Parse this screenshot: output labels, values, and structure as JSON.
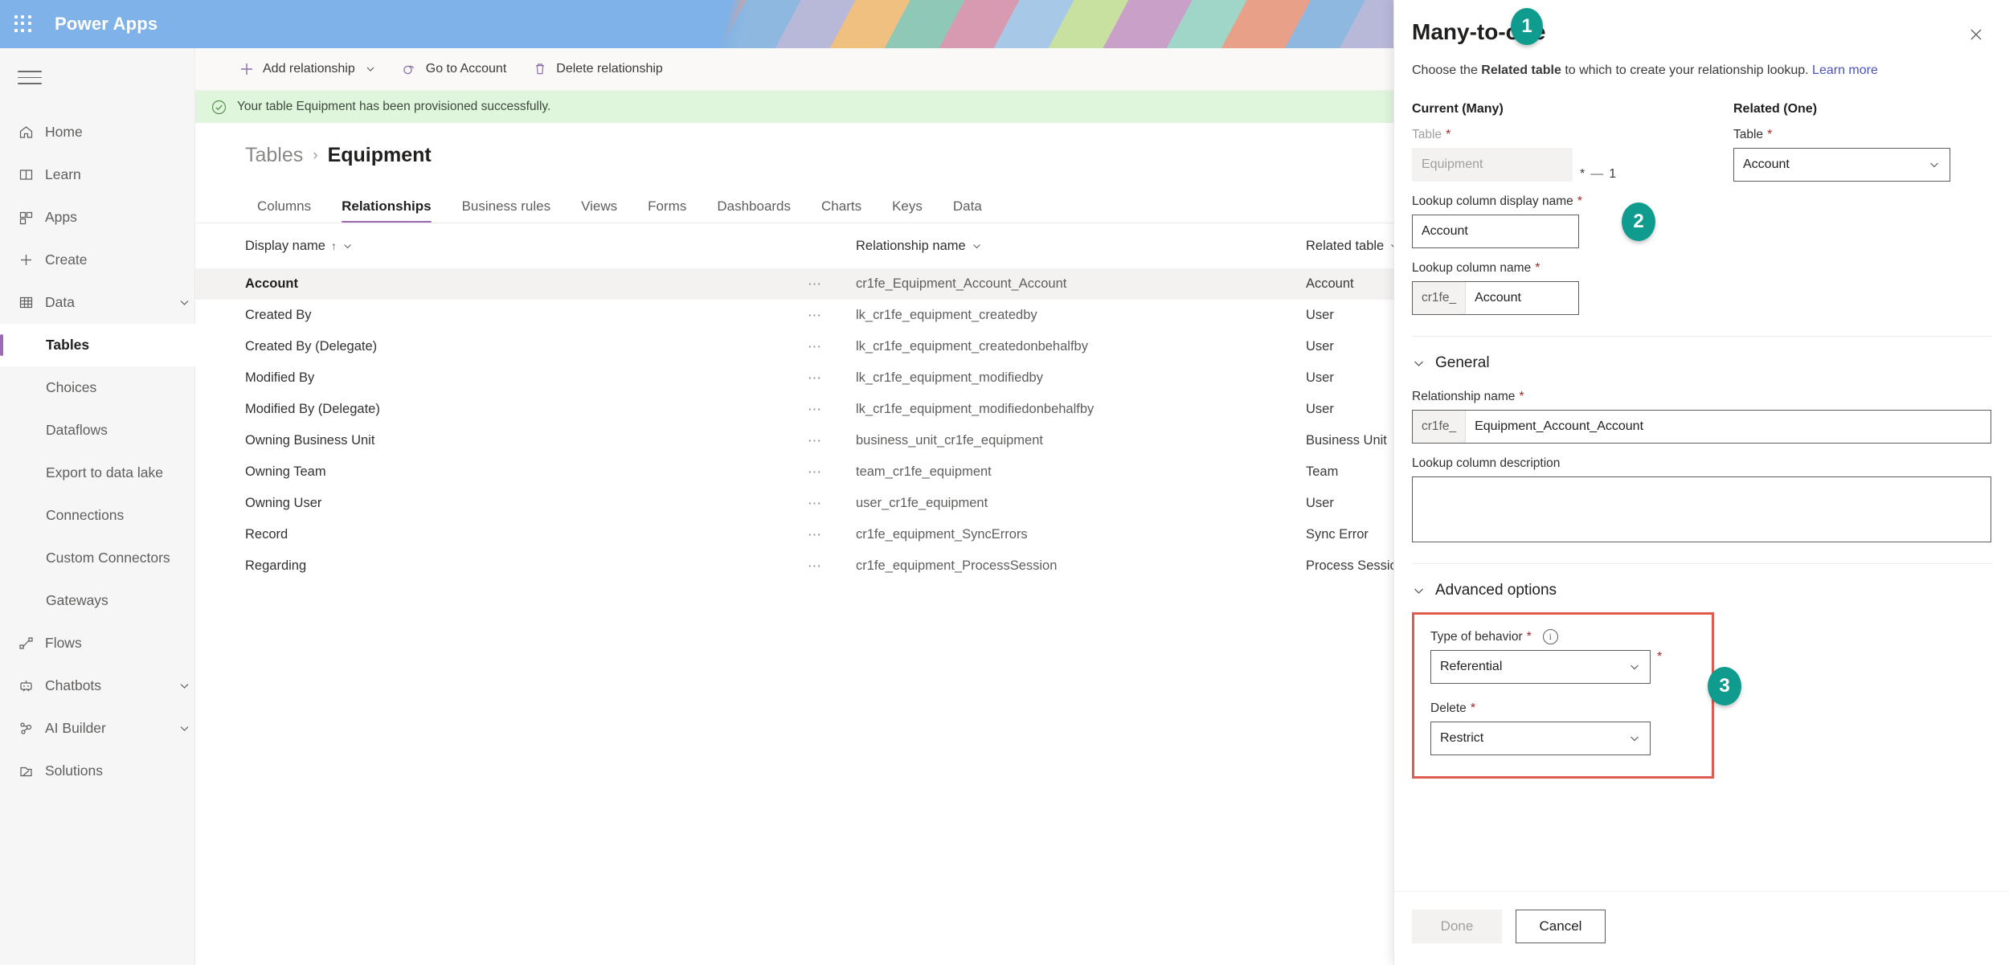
{
  "suite": {
    "waffle_icon": "waffle-grid-icon",
    "brand": "Power Apps"
  },
  "leftnav": {
    "hamburger_icon": "hamburger-menu-icon",
    "items": [
      {
        "label": "Home",
        "icon": "home-icon",
        "sub": false,
        "active": false,
        "chevron": false
      },
      {
        "label": "Learn",
        "icon": "book-icon",
        "sub": false,
        "active": false,
        "chevron": false
      },
      {
        "label": "Apps",
        "icon": "apps-grid-icon",
        "sub": false,
        "active": false,
        "chevron": false
      },
      {
        "label": "Create",
        "icon": "plus-icon",
        "sub": false,
        "active": false,
        "chevron": false
      },
      {
        "label": "Data",
        "icon": "table-icon",
        "sub": false,
        "active": false,
        "chevron": true
      },
      {
        "label": "Tables",
        "icon": "",
        "sub": true,
        "active": true,
        "chevron": false
      },
      {
        "label": "Choices",
        "icon": "",
        "sub": true,
        "active": false,
        "chevron": false
      },
      {
        "label": "Dataflows",
        "icon": "",
        "sub": true,
        "active": false,
        "chevron": false
      },
      {
        "label": "Export to data lake",
        "icon": "",
        "sub": true,
        "active": false,
        "chevron": false
      },
      {
        "label": "Connections",
        "icon": "",
        "sub": true,
        "active": false,
        "chevron": false
      },
      {
        "label": "Custom Connectors",
        "icon": "",
        "sub": true,
        "active": false,
        "chevron": false
      },
      {
        "label": "Gateways",
        "icon": "",
        "sub": true,
        "active": false,
        "chevron": false
      },
      {
        "label": "Flows",
        "icon": "flow-icon",
        "sub": false,
        "active": false,
        "chevron": false
      },
      {
        "label": "Chatbots",
        "icon": "chatbot-icon",
        "sub": false,
        "active": false,
        "chevron": true
      },
      {
        "label": "AI Builder",
        "icon": "ai-builder-icon",
        "sub": false,
        "active": false,
        "chevron": true
      },
      {
        "label": "Solutions",
        "icon": "solutions-icon",
        "sub": false,
        "active": false,
        "chevron": false
      }
    ]
  },
  "command_bar": {
    "add_relationship": "Add relationship",
    "go_to_account": "Go to Account",
    "delete_relationship": "Delete relationship"
  },
  "banner": {
    "icon": "check-circle-icon",
    "message": "Your table Equipment has been provisioned successfully.",
    "background": "#dff6dd"
  },
  "breadcrumb": {
    "parent": "Tables",
    "separator": "›",
    "current": "Equipment"
  },
  "tabs": [
    {
      "label": "Columns",
      "active": false
    },
    {
      "label": "Relationships",
      "active": true
    },
    {
      "label": "Business rules",
      "active": false
    },
    {
      "label": "Views",
      "active": false
    },
    {
      "label": "Forms",
      "active": false
    },
    {
      "label": "Dashboards",
      "active": false
    },
    {
      "label": "Charts",
      "active": false
    },
    {
      "label": "Keys",
      "active": false
    },
    {
      "label": "Data",
      "active": false
    }
  ],
  "grid": {
    "columns": {
      "display_name": "Display name",
      "sort_indicator": "↑",
      "relationship_name": "Relationship name",
      "related_table": "Related table"
    },
    "rows": [
      {
        "display_name": "Account",
        "relationship_name": "cr1fe_Equipment_Account_Account",
        "related_table": "Account",
        "selected": true
      },
      {
        "display_name": "Created By",
        "relationship_name": "lk_cr1fe_equipment_createdby",
        "related_table": "User",
        "selected": false
      },
      {
        "display_name": "Created By (Delegate)",
        "relationship_name": "lk_cr1fe_equipment_createdonbehalfby",
        "related_table": "User",
        "selected": false
      },
      {
        "display_name": "Modified By",
        "relationship_name": "lk_cr1fe_equipment_modifiedby",
        "related_table": "User",
        "selected": false
      },
      {
        "display_name": "Modified By (Delegate)",
        "relationship_name": "lk_cr1fe_equipment_modifiedonbehalfby",
        "related_table": "User",
        "selected": false
      },
      {
        "display_name": "Owning Business Unit",
        "relationship_name": "business_unit_cr1fe_equipment",
        "related_table": "Business Unit",
        "selected": false
      },
      {
        "display_name": "Owning Team",
        "relationship_name": "team_cr1fe_equipment",
        "related_table": "Team",
        "selected": false
      },
      {
        "display_name": "Owning User",
        "relationship_name": "user_cr1fe_equipment",
        "related_table": "User",
        "selected": false
      },
      {
        "display_name": "Record",
        "relationship_name": "cr1fe_equipment_SyncErrors",
        "related_table": "Sync Error",
        "selected": false
      },
      {
        "display_name": "Regarding",
        "relationship_name": "cr1fe_equipment_ProcessSession",
        "related_table": "Process Session",
        "selected": false
      }
    ],
    "row_menu_glyph": "⋯"
  },
  "panel": {
    "title": "Many-to-one",
    "close_icon": "close-icon",
    "description_before": "Choose the ",
    "description_bold": "Related table",
    "description_after": " to which to create your relationship lookup. ",
    "learn_more": "Learn more",
    "current_group": "Current (Many)",
    "related_group": "Related (One)",
    "current_table_label": "Table",
    "current_table_value": "Equipment",
    "related_table_label": "Table",
    "related_table_value": "Account",
    "cardinality_many": "*",
    "cardinality_dash": "—",
    "cardinality_one": "1",
    "lookup_display_label": "Lookup column display name",
    "lookup_display_value": "Account",
    "lookup_name_label": "Lookup column name",
    "lookup_name_prefix": "cr1fe_",
    "lookup_name_value": "Account",
    "general_section": "General",
    "relationship_name_label": "Relationship name",
    "relationship_name_prefix": "cr1fe_",
    "relationship_name_value": "Equipment_Account_Account",
    "lookup_description_label": "Lookup column description",
    "lookup_description_value": "",
    "advanced_section": "Advanced options",
    "behavior_label": "Type of behavior",
    "behavior_info_icon": "info-icon",
    "behavior_value": "Referential",
    "delete_label": "Delete",
    "delete_value": "Restrict",
    "required_marker": "*",
    "done_button": "Done",
    "cancel_button": "Cancel",
    "highlight_color": "#e05a4e"
  },
  "callouts": [
    {
      "number": "1",
      "color": "#0f9b8e"
    },
    {
      "number": "2",
      "color": "#0f9b8e"
    },
    {
      "number": "3",
      "color": "#0f9b8e"
    }
  ]
}
